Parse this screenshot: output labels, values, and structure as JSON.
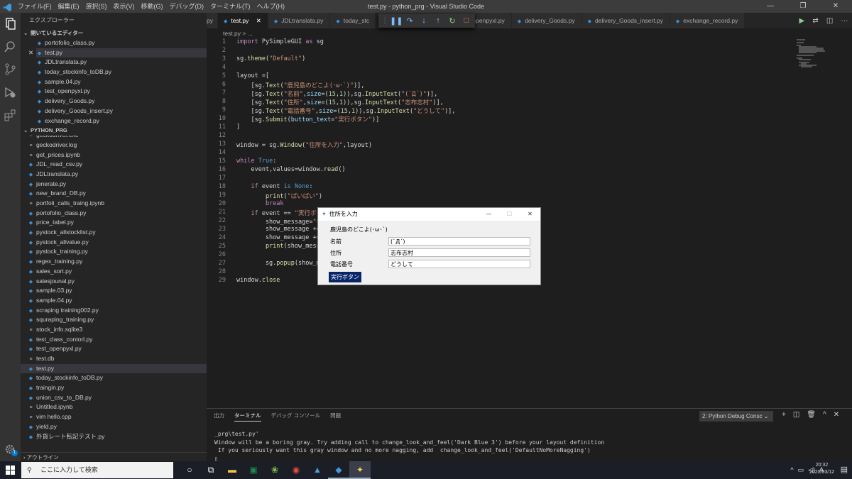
{
  "window": {
    "menu": [
      "ファイル(F)",
      "編集(E)",
      "選択(S)",
      "表示(V)",
      "移動(G)",
      "デバッグ(D)",
      "ターミナル(T)",
      "ヘルプ(H)"
    ],
    "title": "test.py - python_prg - Visual Studio Code"
  },
  "sidebar": {
    "title": "エクスプローラー",
    "open_editors_label": "開いているエディター",
    "open_editors": [
      "portofolio_class.py",
      "test.py",
      "JDLtranslata.py",
      "today_stockinfo_toDB.py",
      "sample.04.py",
      "test_openpyxl.py",
      "delivery_Goods.py",
      "delivery_Goods_insert.py",
      "exchange_record.py"
    ],
    "folder_label": "PYTHON_PRG",
    "files": [
      "geckodriver.exe",
      "geckodriver.log",
      "get_prices.ipynb",
      "JDL_read_csv.py",
      "JDLtranslata.py",
      "jenerate.py",
      "new_brand_DB.py",
      "portfoli_calls_traing.ipynb",
      "portofolio_class.py",
      "price_tabel.py",
      "pystock_allstocklist.py",
      "pystock_allvalue.py",
      "pystock_training.py",
      "regex_training.py",
      "sales_sort.py",
      "salesjounal.py",
      "sample.03.py",
      "sample.04.py",
      "scraping training002.py",
      "squraping_training.py",
      "stock_info.sqlite3",
      "test_class_contorl.py",
      "test_openpyxl.py",
      "test.db",
      "test.py",
      "today_stockinfo_toDB.py",
      "traingin.py",
      "union_csv_to_DB.py",
      "Untitled.ipynb",
      "vim hello.cpp",
      "yield.py",
      "外貨レート転記テスト.py"
    ],
    "outline_label": "アウトライン",
    "badge": "1"
  },
  "tabs": [
    "py",
    "test.py",
    "JDLtranslata.py",
    "today_stc",
    "y",
    "test_openpyxl.py",
    "delivery_Goods.py",
    "delivery_Goods_insert.py",
    "exchange_record.py"
  ],
  "breadcrumb": "test.py > ...",
  "code_lines": [
    "1",
    "2",
    "3",
    "4",
    "5",
    "6",
    "7",
    "8",
    "9",
    "10",
    "11",
    "12",
    "13",
    "14",
    "15",
    "16",
    "17",
    "18",
    "19",
    "20",
    "21",
    "22",
    "23",
    "24",
    "25",
    "26",
    "27",
    "28",
    "29"
  ],
  "panel": {
    "tabs": [
      "出力",
      "ターミナル",
      "デバッグ コンソール",
      "問題"
    ],
    "terminal_select": "2: Python Debug Consc",
    "lines": [
      "_prg\\test.py'",
      "Window will be a boring gray. Try adding call to change_look_and_feel('Dark Blue 3') before your layout definition",
      " If you seriously want this gray window and no more nagging, add  change_look_and_feel('DefaultNoMoreNagging')"
    ]
  },
  "dialog": {
    "title": "住所を入力",
    "heading": "鹿児島のどこよ(･ω･`)",
    "fields": [
      {
        "label": "名前",
        "value": "(`Д´)"
      },
      {
        "label": "住所",
        "value": "志布志村"
      },
      {
        "label": "電話番号",
        "value": "どうして"
      }
    ],
    "button": "実行ボタン"
  },
  "taskbar": {
    "search_placeholder": "ここに入力して検索",
    "ime": "A",
    "time": "20:32",
    "date": "2020/03/12"
  }
}
